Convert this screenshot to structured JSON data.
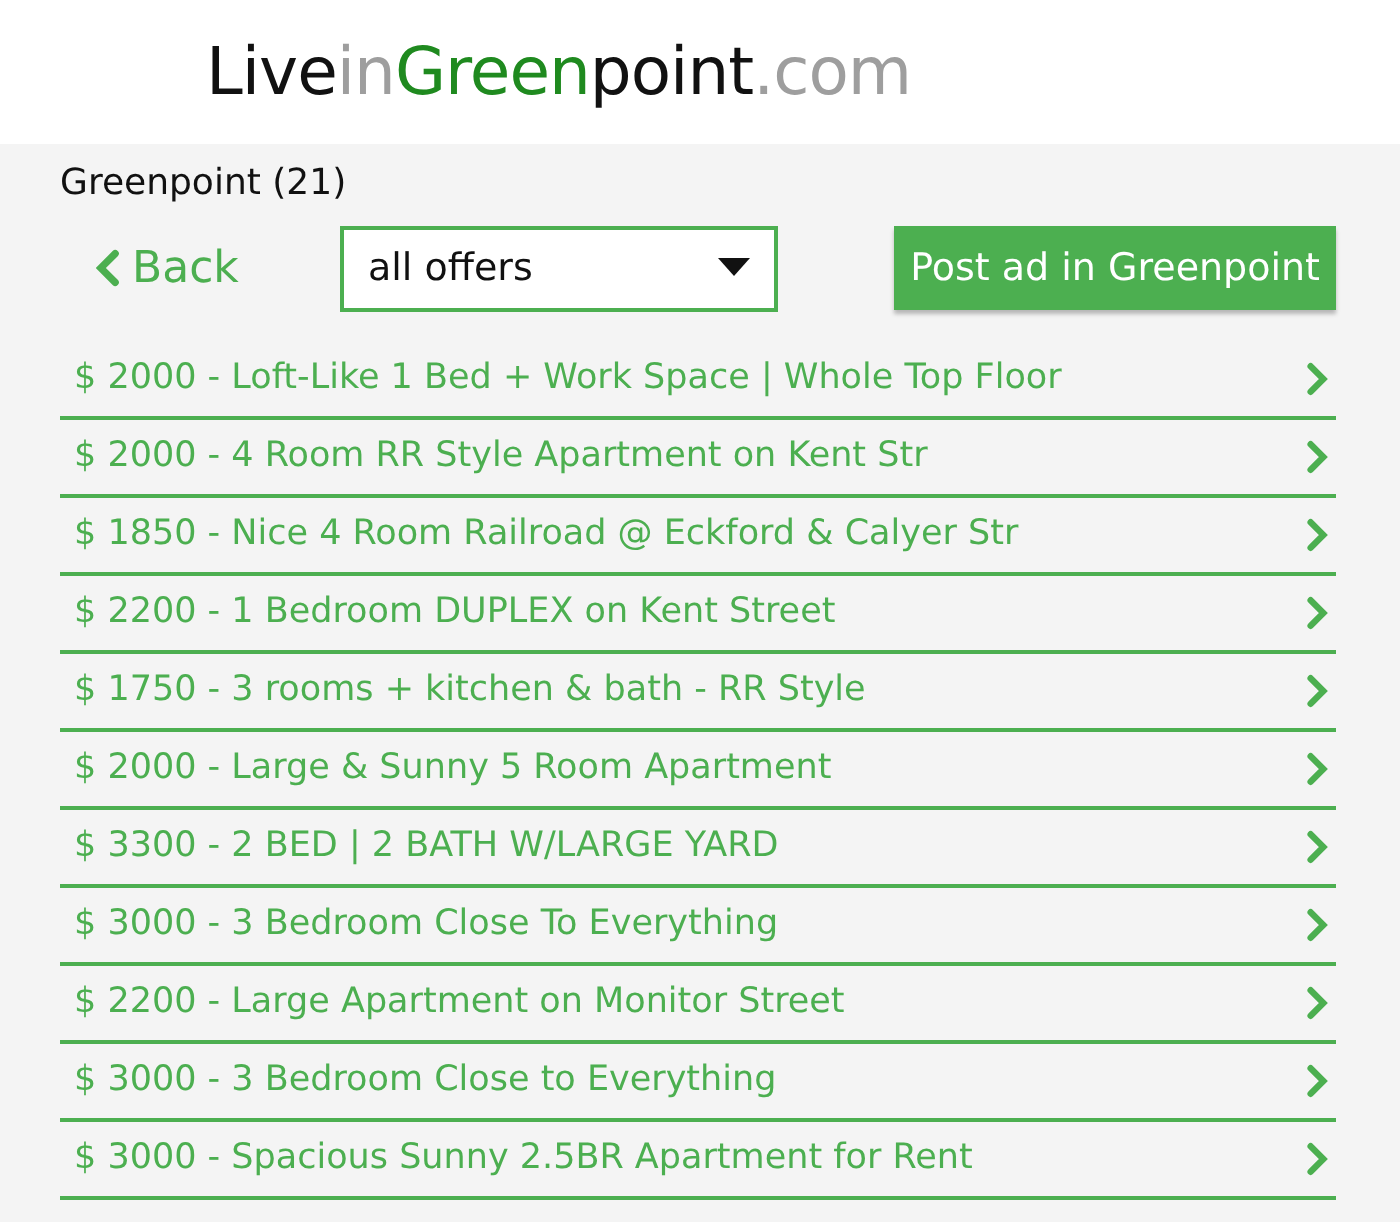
{
  "logo": [
    {
      "text": "Live",
      "color": "#111111"
    },
    {
      "text": "in",
      "color": "#9e9e9e"
    },
    {
      "text": "Green",
      "color": "#1f8a1f"
    },
    {
      "text": "point",
      "color": "#111111"
    },
    {
      "text": ".com",
      "color": "#9e9e9e"
    }
  ],
  "heading": "Greenpoint (21)",
  "back_link": "Back",
  "filter": {
    "value": "all offers"
  },
  "post_button": "Post ad in Greenpoint",
  "listings": [
    {
      "title": "$ 2000 - Loft-Like 1 Bed + Work Space | Whole Top Floor"
    },
    {
      "title": "$ 2000 - 4 Room RR Style Apartment on Kent Str"
    },
    {
      "title": "$ 1850 - Nice 4 Room Railroad @ Eckford & Calyer Str"
    },
    {
      "title": "$ 2200 - 1 Bedroom DUPLEX on Kent Street"
    },
    {
      "title": "$ 1750 - 3 rooms + kitchen & bath - RR Style"
    },
    {
      "title": "$ 2000 - Large & Sunny 5 Room Apartment"
    },
    {
      "title": "$ 3300 - 2 BED | 2 BATH W/LARGE YARD"
    },
    {
      "title": "$ 3000 - 3 Bedroom Close To Everything"
    },
    {
      "title": "$ 2200 - Large Apartment on Monitor Street"
    },
    {
      "title": "$ 3000 - 3 Bedroom Close to Everything"
    },
    {
      "title": "$ 3000 - Spacious Sunny 2.5BR Apartment for Rent"
    }
  ]
}
